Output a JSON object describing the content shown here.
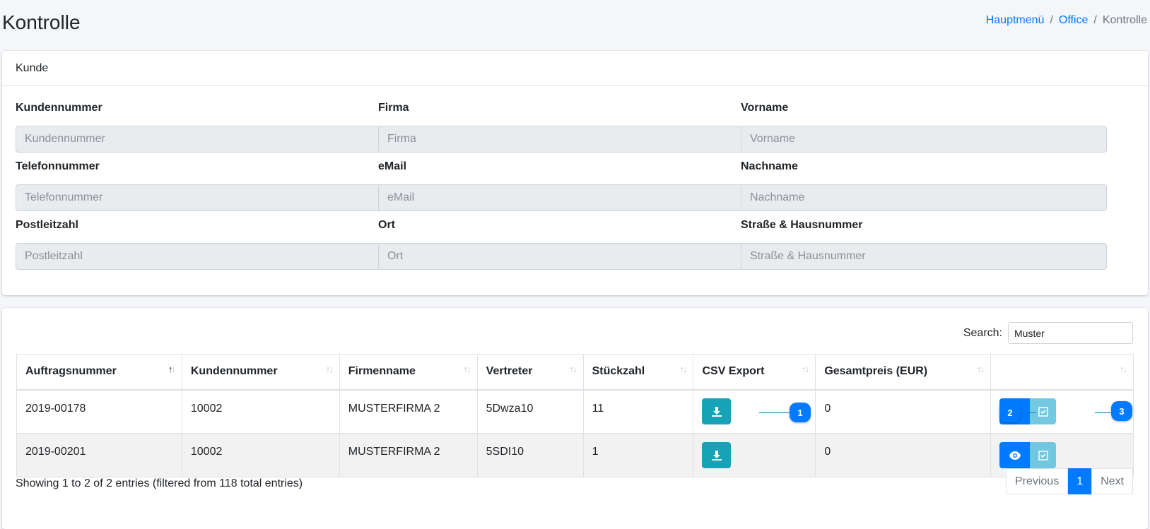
{
  "page": {
    "title": "Kontrolle",
    "breadcrumb": [
      "Hauptmenü",
      "Office",
      "Kontrolle"
    ]
  },
  "customer_card": {
    "header": "Kunde",
    "fields": [
      {
        "label": "Kundennummer",
        "placeholder": "Kundennummer"
      },
      {
        "label": "Firma",
        "placeholder": "Firma"
      },
      {
        "label": "Vorname",
        "placeholder": "Vorname"
      },
      {
        "label": "Telefonnummer",
        "placeholder": "Telefonnummer"
      },
      {
        "label": "eMail",
        "placeholder": "eMail"
      },
      {
        "label": "Nachname",
        "placeholder": "Nachname"
      },
      {
        "label": "Postleitzahl",
        "placeholder": "Postleitzahl"
      },
      {
        "label": "Ort",
        "placeholder": "Ort"
      },
      {
        "label": "Straße & Hausnummer",
        "placeholder": "Straße & Hausnummer"
      }
    ]
  },
  "orders_table": {
    "search_label": "Search:",
    "search_value": "Muster",
    "columns": [
      "Auftragsnummer",
      "Kundennummer",
      "Firmenname",
      "Vertreter",
      "Stückzahl",
      "CSV Export",
      "Gesamtpreis (EUR)",
      ""
    ],
    "sorted_column": "Auftragsnummer",
    "rows": [
      {
        "auftragsnummer": "2019-00178",
        "kundennummer": "10002",
        "firmenname": "MUSTERFIRMA 2",
        "vertreter": "5Dwza10",
        "stueckzahl": "11",
        "gesamtpreis": "0"
      },
      {
        "auftragsnummer": "2019-00201",
        "kundennummer": "10002",
        "firmenname": "MUSTERFIRMA 2",
        "vertreter": "5SDI10",
        "stueckzahl": "1",
        "gesamtpreis": "0"
      }
    ],
    "info": "Showing 1 to 2 of 2 entries (filtered from 118 total entries)",
    "pagination": {
      "previous": "Previous",
      "current": "1",
      "next": "Next"
    }
  },
  "callouts": [
    "1",
    "2",
    "3"
  ],
  "icons": {
    "download": "download-icon",
    "view": "eye-icon",
    "check": "check-square-icon"
  },
  "colors": {
    "primary": "#007bff",
    "info": "#17a2b8",
    "info_light": "#5bc0de",
    "bg": "#f4f6f9"
  }
}
